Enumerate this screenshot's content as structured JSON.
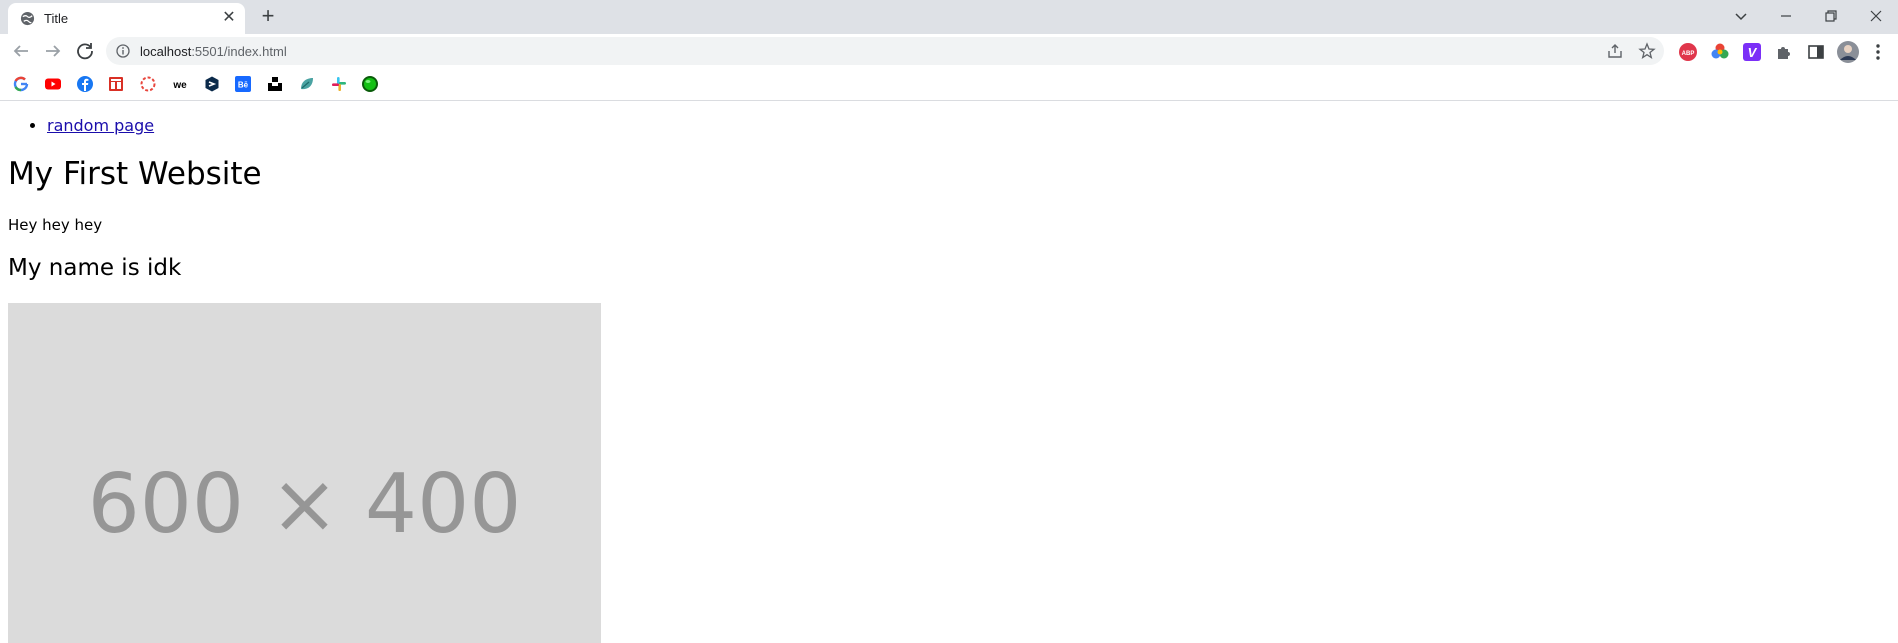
{
  "browser": {
    "tab": {
      "title": "Title",
      "favicon": "globe-icon"
    },
    "new_tab_icon": "plus-icon",
    "window_controls": [
      "chevron-down-icon",
      "minimize-icon",
      "restore-icon",
      "close-icon"
    ],
    "address": {
      "host": "localhost",
      "path": ":5501/index.html",
      "info_icon": "info-icon"
    },
    "omnibox_icons": [
      "share-icon",
      "star-icon"
    ],
    "extensions": [
      "abp-icon",
      "color-wheel-icon",
      "v-extension-icon",
      "puzzle-icon",
      "side-panel-icon",
      "profile-avatar",
      "menu-dots-icon"
    ],
    "abp_label": "ABP",
    "v_label": "V",
    "bookmarks": [
      "google-icon",
      "youtube-icon",
      "facebook-icon",
      "gift-icon",
      "red-circle-icon",
      "we-icon",
      "dark-shield-icon",
      "behance-icon",
      "unsplash-icon",
      "leaf-icon",
      "slack-icon",
      "green-orb-icon"
    ],
    "bookmark_labels": {
      "we": "we",
      "behance": "Bē"
    }
  },
  "page": {
    "nav_link": "random page",
    "heading": "My First Website",
    "paragraph": "Hey hey hey",
    "subheading": "My name is idk",
    "image_placeholder_text": "600 × 400"
  },
  "colors": {
    "tabstrip": "#dee1e6",
    "omnibox": "#f1f3f4",
    "link": "#1a0dab",
    "placeholder_bg": "#dbdbdb",
    "placeholder_text": "#969696"
  }
}
